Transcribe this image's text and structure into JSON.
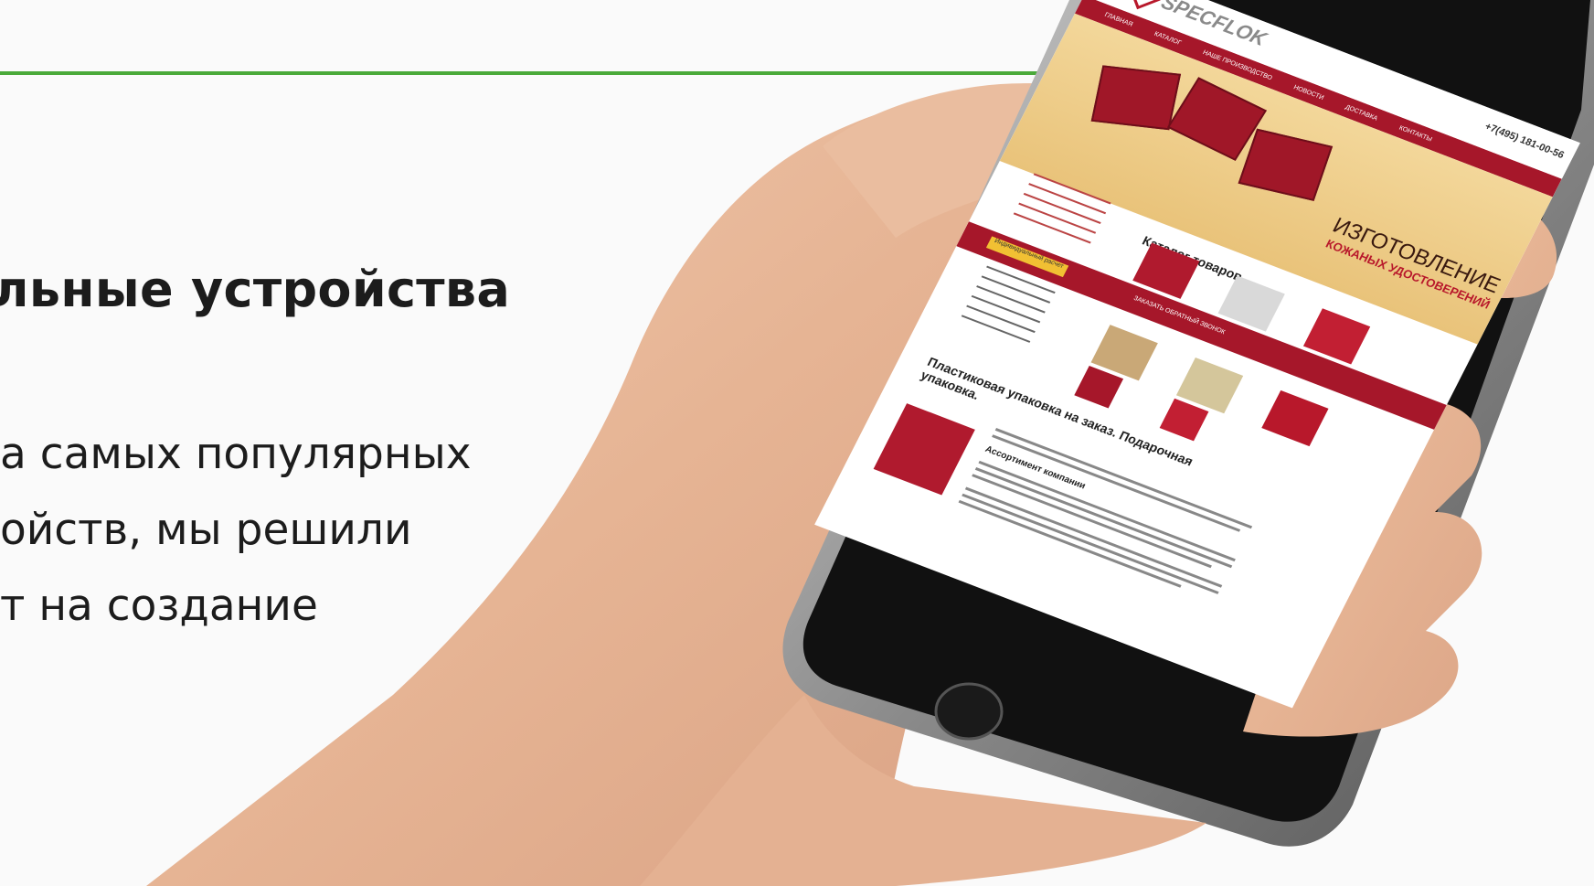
{
  "slide": {
    "heading": "льные устройства",
    "paragraph_lines": [
      "а самых популярных",
      "ойств, мы решили",
      "т на создание"
    ]
  },
  "phone_site": {
    "logo": "SPECFLOK",
    "phone": "+7(495) 181-00-56",
    "nav": [
      "ГЛАВНАЯ",
      "КАТАЛОГ",
      "НАШЕ ПРОИЗВОДСТВО",
      "НОВОСТИ",
      "ДОСТАВКА",
      "КОНТАКТЫ"
    ],
    "hero_title": "ИЗГОТОВЛЕНИЕ",
    "hero_subtitle": "КОЖАНЫХ УДОСТОВЕРЕНИЙ",
    "catalog_title": "Каталог товаров",
    "badge": "Индивидуальный расчет",
    "bar_text": "ЗАКАЗАТЬ ОБРАТНЫЙ ЗВОНОК",
    "block_title": "Пластиковая упаковка на заказ. Подарочная",
    "block_title2": "упаковка.",
    "block_subtitle": "Ассортимент компании"
  },
  "colors": {
    "accent_green": "#4aaa3a",
    "brand_red": "#a6172a"
  }
}
